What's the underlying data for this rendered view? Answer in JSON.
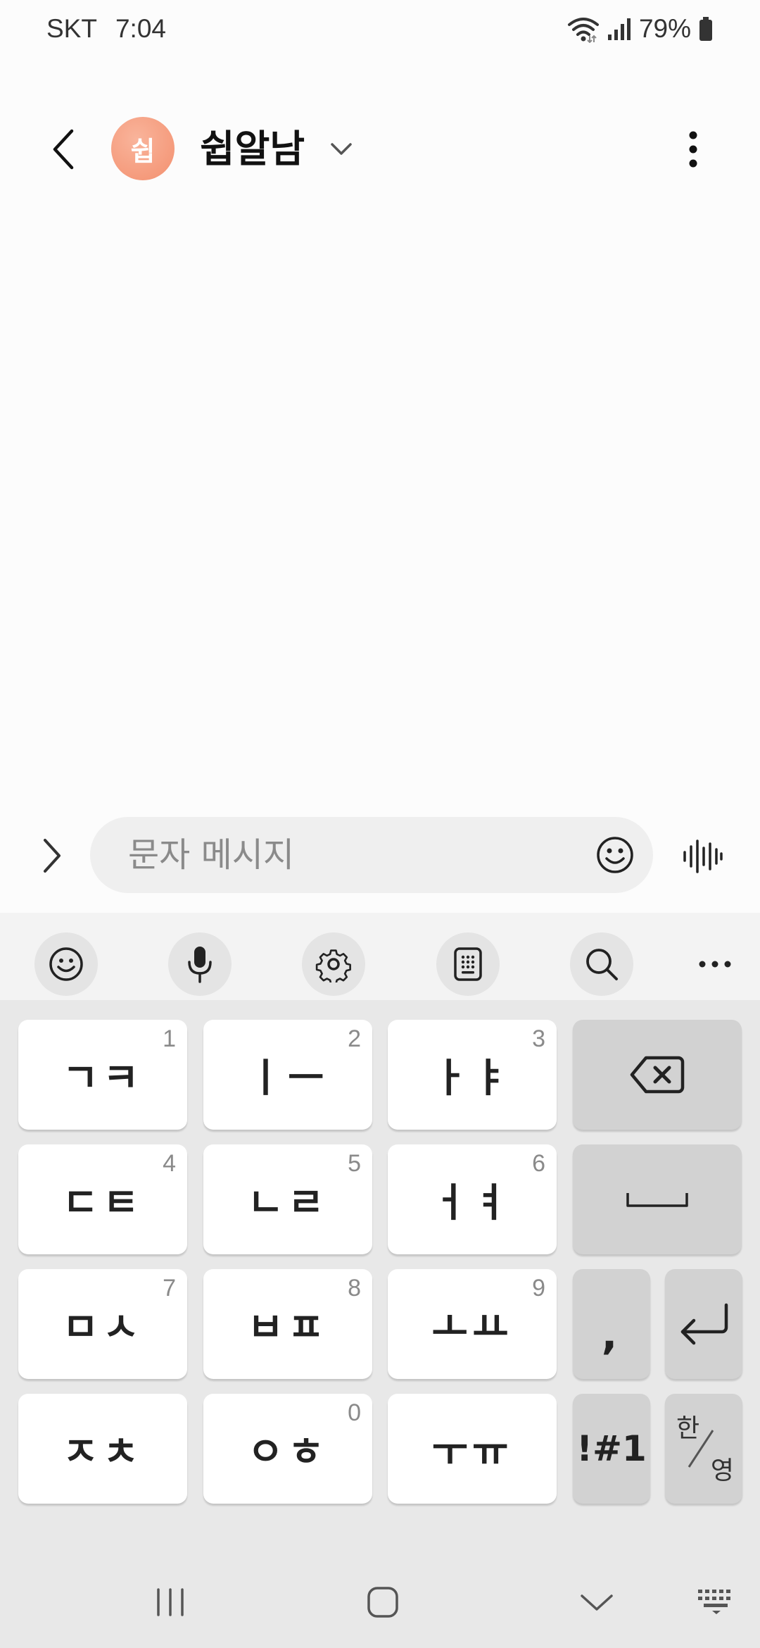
{
  "status_bar": {
    "carrier": "SKT",
    "time": "7:04",
    "battery": "79%",
    "icons": [
      "wifi-icon",
      "signal-icon",
      "battery-icon"
    ]
  },
  "header": {
    "avatar_initial": "쉽",
    "contact_name": "쉽알남",
    "avatar_color": "#f3906f"
  },
  "compose": {
    "placeholder": "문자 메시지",
    "value": ""
  },
  "keyboard_toolbar": {
    "items": [
      "emoji-icon",
      "microphone-icon",
      "settings-icon",
      "clipboard-icon",
      "search-icon",
      "more-icon"
    ]
  },
  "keyboard": {
    "rows": [
      [
        {
          "label": "ㄱㅋ",
          "num": "1"
        },
        {
          "label": "ㅣㅡ",
          "num": "2"
        },
        {
          "label": "ㅏㅑ",
          "num": "3"
        }
      ],
      [
        {
          "label": "ㄷㅌ",
          "num": "4"
        },
        {
          "label": "ㄴㄹ",
          "num": "5"
        },
        {
          "label": "ㅓㅕ",
          "num": "6"
        }
      ],
      [
        {
          "label": "ㅁㅅ",
          "num": "7"
        },
        {
          "label": "ㅂㅍ",
          "num": "8"
        },
        {
          "label": "ㅗㅛ",
          "num": "9"
        }
      ],
      [
        {
          "label": "ㅈㅊ",
          "num": ""
        },
        {
          "label": "ㅇㅎ",
          "num": "0"
        },
        {
          "label": "ㅜㅠ",
          "num": ""
        }
      ]
    ],
    "comma_label": ",",
    "symbols_label": "!#1",
    "lang_top": "한",
    "lang_bottom": "영"
  },
  "navbar": {
    "items": [
      "recents-icon",
      "home-icon",
      "back-down-icon",
      "keyboard-icon"
    ]
  }
}
